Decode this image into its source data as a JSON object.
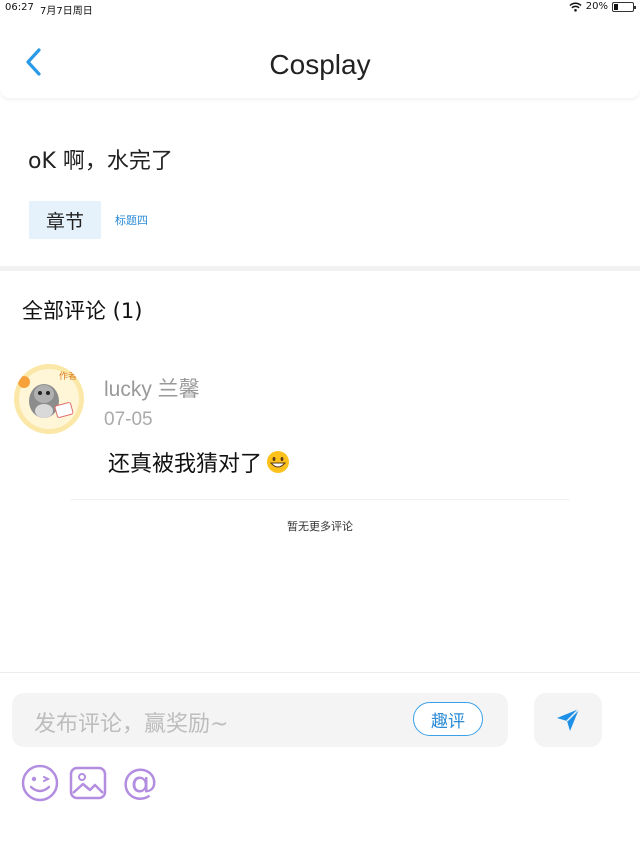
{
  "status_bar": {
    "time": "06:27",
    "date": "7月7日周日",
    "battery": "20%",
    "battery_level": 0.2
  },
  "header": {
    "title": "Cosplay"
  },
  "post": {
    "text": "oK 啊，水完了",
    "chapter_tag": "章节",
    "chapter_title": "标题四"
  },
  "comments": {
    "heading": "全部评论 (1)",
    "items": [
      {
        "username": "lucky 兰馨",
        "date": "07-05",
        "text": "还真被我猜对了",
        "avatar_badge": "作者"
      }
    ],
    "no_more": "暂无更多评论"
  },
  "composer": {
    "placeholder": "发布评论，赢奖励~",
    "qp_button": "趣评"
  },
  "icons": {
    "back": "chevron-left-icon",
    "send": "send-icon",
    "emoji": "emoji-icon",
    "image": "image-icon",
    "mention": "at-icon",
    "wifi": "wifi-icon"
  },
  "colors": {
    "accent": "#2a8ad6",
    "send_blue": "#1e90e8",
    "tool_purple": "#b38ee0",
    "tag_bg": "#e6f2fb"
  }
}
